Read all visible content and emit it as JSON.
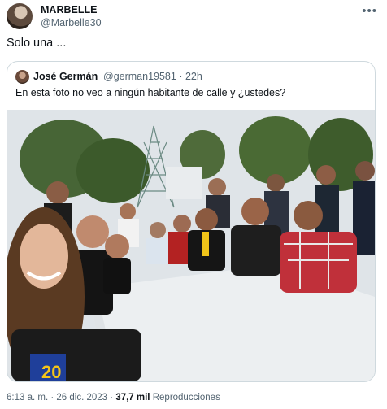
{
  "tweet": {
    "display_name": "MARBELLE",
    "handle": "@Marbelle30",
    "more_icon": "more-icon",
    "text": "Solo una ..."
  },
  "quoted": {
    "display_name": "José Germán",
    "handle": "@german19581",
    "time": "22h",
    "text": "En esta foto no veo a ningún habitante de calle y ¿ustedes?",
    "photo_badge_text": "20"
  },
  "meta": {
    "time": "6:13 a. m.",
    "separator": "·",
    "date": "26 dic. 2023",
    "views": "37,7 mil",
    "views_label": "Reproducciones"
  }
}
